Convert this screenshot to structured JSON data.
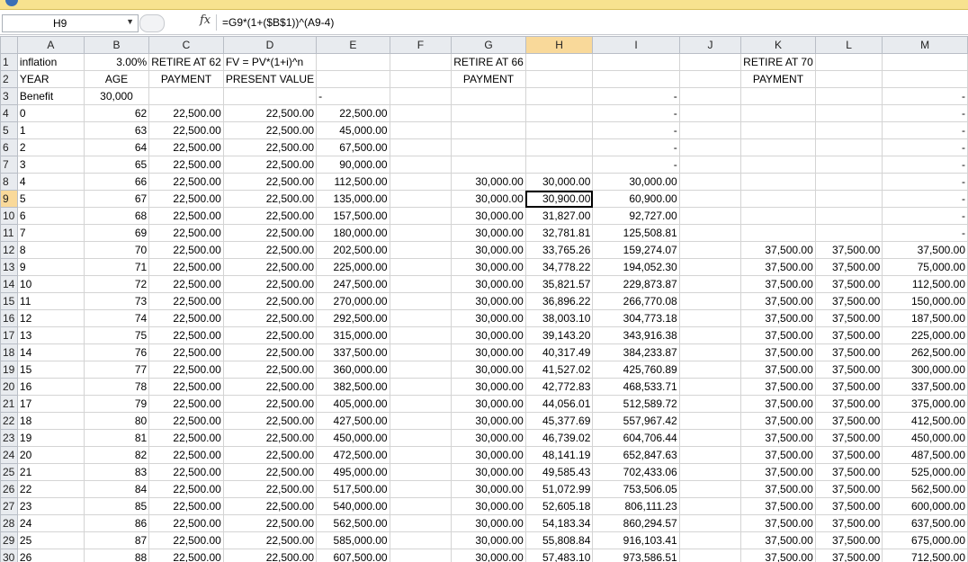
{
  "formula_bar": {
    "name_box": "H9",
    "formula": "=G9*(1+($B$1))^(A9-4)"
  },
  "icons": {
    "namebox_dropdown": "chevron-down-icon",
    "fx": "fx-icon",
    "cancel": "cancel-circle-icon",
    "protected": "shield-icon"
  },
  "columns": [
    "",
    "A",
    "B",
    "C",
    "D",
    "E",
    "F",
    "G",
    "H",
    "I",
    "J",
    "K",
    "L",
    "M"
  ],
  "selected": {
    "row": 9,
    "col": "H"
  },
  "rows": [
    [
      "1",
      "inflation",
      "3.00%",
      "RETIRE AT 62",
      "FV = PV*(1+i)^n",
      "",
      "",
      "RETIRE AT 66",
      "",
      "",
      "",
      "RETIRE AT 70",
      "",
      ""
    ],
    [
      "2",
      "YEAR",
      "AGE",
      "PAYMENT",
      "PRESENT VALUE",
      "",
      "",
      "PAYMENT",
      "",
      "",
      "",
      "PAYMENT",
      "",
      ""
    ],
    [
      "3",
      "Benefit",
      "30,000",
      "",
      "",
      "-",
      "",
      "",
      "",
      "-",
      "",
      "",
      "",
      "-"
    ],
    [
      "4",
      "0",
      "62",
      "22,500.00",
      "22,500.00",
      "22,500.00",
      "",
      "",
      "",
      "-",
      "",
      "",
      "",
      "-"
    ],
    [
      "5",
      "1",
      "63",
      "22,500.00",
      "22,500.00",
      "45,000.00",
      "",
      "",
      "",
      "-",
      "",
      "",
      "",
      "-"
    ],
    [
      "6",
      "2",
      "64",
      "22,500.00",
      "22,500.00",
      "67,500.00",
      "",
      "",
      "",
      "-",
      "",
      "",
      "",
      "-"
    ],
    [
      "7",
      "3",
      "65",
      "22,500.00",
      "22,500.00",
      "90,000.00",
      "",
      "",
      "",
      "-",
      "",
      "",
      "",
      "-"
    ],
    [
      "8",
      "4",
      "66",
      "22,500.00",
      "22,500.00",
      "112,500.00",
      "",
      "30,000.00",
      "30,000.00",
      "30,000.00",
      "",
      "",
      "",
      "-"
    ],
    [
      "9",
      "5",
      "67",
      "22,500.00",
      "22,500.00",
      "135,000.00",
      "",
      "30,000.00",
      "30,900.00",
      "60,900.00",
      "",
      "",
      "",
      "-"
    ],
    [
      "10",
      "6",
      "68",
      "22,500.00",
      "22,500.00",
      "157,500.00",
      "",
      "30,000.00",
      "31,827.00",
      "92,727.00",
      "",
      "",
      "",
      "-"
    ],
    [
      "11",
      "7",
      "69",
      "22,500.00",
      "22,500.00",
      "180,000.00",
      "",
      "30,000.00",
      "32,781.81",
      "125,508.81",
      "",
      "",
      "",
      "-"
    ],
    [
      "12",
      "8",
      "70",
      "22,500.00",
      "22,500.00",
      "202,500.00",
      "",
      "30,000.00",
      "33,765.26",
      "159,274.07",
      "",
      "37,500.00",
      "37,500.00",
      "37,500.00"
    ],
    [
      "13",
      "9",
      "71",
      "22,500.00",
      "22,500.00",
      "225,000.00",
      "",
      "30,000.00",
      "34,778.22",
      "194,052.30",
      "",
      "37,500.00",
      "37,500.00",
      "75,000.00"
    ],
    [
      "14",
      "10",
      "72",
      "22,500.00",
      "22,500.00",
      "247,500.00",
      "",
      "30,000.00",
      "35,821.57",
      "229,873.87",
      "",
      "37,500.00",
      "37,500.00",
      "112,500.00"
    ],
    [
      "15",
      "11",
      "73",
      "22,500.00",
      "22,500.00",
      "270,000.00",
      "",
      "30,000.00",
      "36,896.22",
      "266,770.08",
      "",
      "37,500.00",
      "37,500.00",
      "150,000.00"
    ],
    [
      "16",
      "12",
      "74",
      "22,500.00",
      "22,500.00",
      "292,500.00",
      "",
      "30,000.00",
      "38,003.10",
      "304,773.18",
      "",
      "37,500.00",
      "37,500.00",
      "187,500.00"
    ],
    [
      "17",
      "13",
      "75",
      "22,500.00",
      "22,500.00",
      "315,000.00",
      "",
      "30,000.00",
      "39,143.20",
      "343,916.38",
      "",
      "37,500.00",
      "37,500.00",
      "225,000.00"
    ],
    [
      "18",
      "14",
      "76",
      "22,500.00",
      "22,500.00",
      "337,500.00",
      "",
      "30,000.00",
      "40,317.49",
      "384,233.87",
      "",
      "37,500.00",
      "37,500.00",
      "262,500.00"
    ],
    [
      "19",
      "15",
      "77",
      "22,500.00",
      "22,500.00",
      "360,000.00",
      "",
      "30,000.00",
      "41,527.02",
      "425,760.89",
      "",
      "37,500.00",
      "37,500.00",
      "300,000.00"
    ],
    [
      "20",
      "16",
      "78",
      "22,500.00",
      "22,500.00",
      "382,500.00",
      "",
      "30,000.00",
      "42,772.83",
      "468,533.71",
      "",
      "37,500.00",
      "37,500.00",
      "337,500.00"
    ],
    [
      "21",
      "17",
      "79",
      "22,500.00",
      "22,500.00",
      "405,000.00",
      "",
      "30,000.00",
      "44,056.01",
      "512,589.72",
      "",
      "37,500.00",
      "37,500.00",
      "375,000.00"
    ],
    [
      "22",
      "18",
      "80",
      "22,500.00",
      "22,500.00",
      "427,500.00",
      "",
      "30,000.00",
      "45,377.69",
      "557,967.42",
      "",
      "37,500.00",
      "37,500.00",
      "412,500.00"
    ],
    [
      "23",
      "19",
      "81",
      "22,500.00",
      "22,500.00",
      "450,000.00",
      "",
      "30,000.00",
      "46,739.02",
      "604,706.44",
      "",
      "37,500.00",
      "37,500.00",
      "450,000.00"
    ],
    [
      "24",
      "20",
      "82",
      "22,500.00",
      "22,500.00",
      "472,500.00",
      "",
      "30,000.00",
      "48,141.19",
      "652,847.63",
      "",
      "37,500.00",
      "37,500.00",
      "487,500.00"
    ],
    [
      "25",
      "21",
      "83",
      "22,500.00",
      "22,500.00",
      "495,000.00",
      "",
      "30,000.00",
      "49,585.43",
      "702,433.06",
      "",
      "37,500.00",
      "37,500.00",
      "525,000.00"
    ],
    [
      "26",
      "22",
      "84",
      "22,500.00",
      "22,500.00",
      "517,500.00",
      "",
      "30,000.00",
      "51,072.99",
      "753,506.05",
      "",
      "37,500.00",
      "37,500.00",
      "562,500.00"
    ],
    [
      "27",
      "23",
      "85",
      "22,500.00",
      "22,500.00",
      "540,000.00",
      "",
      "30,000.00",
      "52,605.18",
      "806,111.23",
      "",
      "37,500.00",
      "37,500.00",
      "600,000.00"
    ],
    [
      "28",
      "24",
      "86",
      "22,500.00",
      "22,500.00",
      "562,500.00",
      "",
      "30,000.00",
      "54,183.34",
      "860,294.57",
      "",
      "37,500.00",
      "37,500.00",
      "637,500.00"
    ],
    [
      "29",
      "25",
      "87",
      "22,500.00",
      "22,500.00",
      "585,000.00",
      "",
      "30,000.00",
      "55,808.84",
      "916,103.41",
      "",
      "37,500.00",
      "37,500.00",
      "675,000.00"
    ],
    [
      "30",
      "26",
      "88",
      "22,500.00",
      "22,500.00",
      "607,500.00",
      "",
      "30,000.00",
      "57,483.10",
      "973,586.51",
      "",
      "37,500.00",
      "37,500.00",
      "712,500.00"
    ]
  ]
}
